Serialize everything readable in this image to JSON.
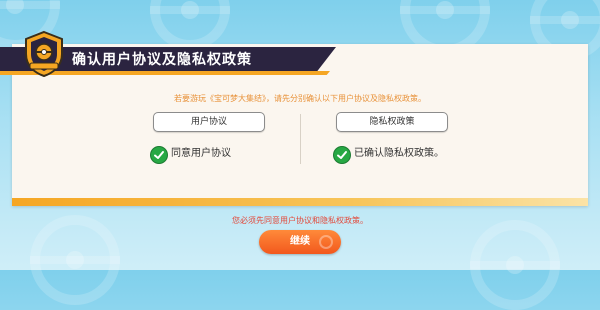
{
  "dialog": {
    "title": "确认用户协议及隐私权政策",
    "notice": "若要游玩《宝可梦大集结》，请先分别确认以下用户协议及隐私权政策。",
    "user_agreement_button": "用户协议",
    "privacy_policy_button": "隐私权政策",
    "agree_user_agreement_label": "同意用户协议",
    "confirmed_privacy_label": "已确认隐私权政策。",
    "warning": "您必须先同意用户协议和隐私权政策。",
    "continue_button": "继续"
  },
  "colors": {
    "header_bg": "#2b2440",
    "accent_orange": "#f5a623",
    "notice_text": "#e8923a",
    "warning_text": "#e24a3b",
    "check_green": "#27a844",
    "continue_button": "#f2581d"
  },
  "icons": {
    "badge": "unite-badge-icon",
    "check": "checkmark-icon",
    "pokeball": "pokeball-icon"
  }
}
